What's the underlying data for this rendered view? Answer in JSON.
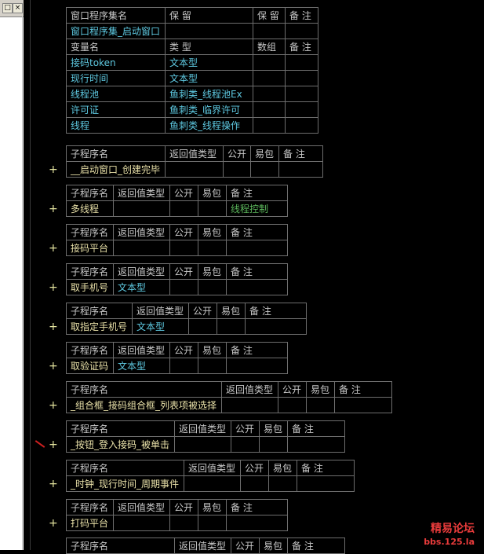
{
  "panel": {
    "btn1": "□",
    "btn2": "×"
  },
  "window_table": {
    "headers": [
      "窗口程序集名",
      "保 留",
      "保 留",
      "备 注"
    ],
    "name": "窗口程序集_启动窗口",
    "var_headers": [
      "变量名",
      "类 型",
      "数组",
      "备 注"
    ],
    "vars": [
      {
        "name": "接码token",
        "type": "文本型"
      },
      {
        "name": "现行时间",
        "type": "文本型"
      },
      {
        "name": "线程池",
        "type": "鱼刺类_线程池Ex"
      },
      {
        "name": "许可证",
        "type": "鱼刺类_临界许可"
      },
      {
        "name": "线程",
        "type": "鱼刺类_线程操作"
      }
    ]
  },
  "sub_headers": [
    "子程序名",
    "返回值类型",
    "公开",
    "易包",
    "备 注"
  ],
  "subs": [
    {
      "name": "__启动窗口_创建完毕",
      "ret": "",
      "note": ""
    },
    {
      "name": "多线程",
      "ret": "",
      "note": "线程控制"
    },
    {
      "name": "接码平台",
      "ret": "",
      "note": ""
    },
    {
      "name": "取手机号",
      "ret": "文本型",
      "note": ""
    },
    {
      "name": "取指定手机号",
      "ret": "文本型",
      "note": ""
    },
    {
      "name": "取验证码",
      "ret": "文本型",
      "note": ""
    },
    {
      "name": "_组合框_接码组合框_列表项被选择",
      "ret": "",
      "note": ""
    },
    {
      "name": "_按钮_登入接码_被单击",
      "ret": "",
      "note": ""
    },
    {
      "name": "_时钟_现行时间_周期事件",
      "ret": "",
      "note": ""
    },
    {
      "name": "打码平台",
      "ret": "",
      "note": ""
    },
    {
      "name": "",
      "ret": "",
      "note": ""
    }
  ],
  "plus_symbol": "+",
  "watermark": {
    "line1": "精易论坛",
    "line2": "bbs.125.la"
  }
}
